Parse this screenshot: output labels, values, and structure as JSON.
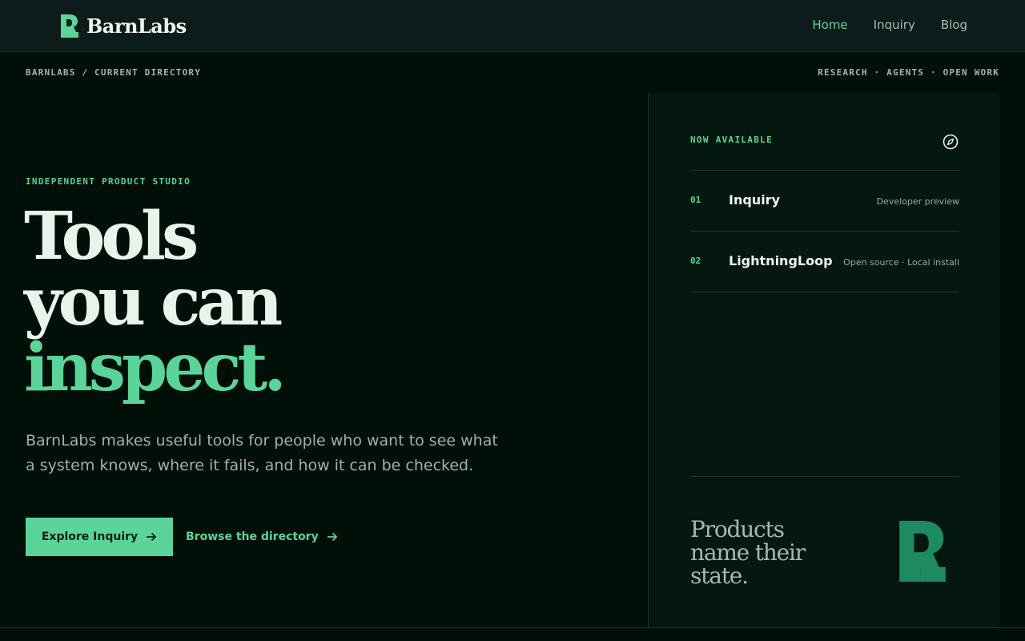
{
  "brand": {
    "name": "BarnLabs",
    "accent": "#5bd499",
    "background": "#000f08"
  },
  "nav": {
    "items": [
      {
        "label": "Home",
        "active": true
      },
      {
        "label": "Inquiry",
        "active": false
      },
      {
        "label": "Blog",
        "active": false
      }
    ]
  },
  "meta": {
    "breadcrumb": "BARNLABS / CURRENT DIRECTORY",
    "tags": "RESEARCH · AGENTS · OPEN WORK"
  },
  "hero": {
    "eyebrow": "INDEPENDENT PRODUCT STUDIO",
    "headline": {
      "line1": "Tools",
      "line2": "you can",
      "line3": "inspect."
    },
    "lede": "BarnLabs makes useful tools for people who want to see what a system knows, where it fails, and how it can be checked.",
    "primary_cta": "Explore Inquiry",
    "secondary_cta": "Browse the directory"
  },
  "panel": {
    "heading": "NOW AVAILABLE",
    "heading_icon": "compass-icon",
    "products": [
      {
        "number": "01",
        "name": "Inquiry",
        "status": "Developer preview"
      },
      {
        "number": "02",
        "name": "LightningLoop",
        "status": "Open source · Local install"
      }
    ],
    "tagline": {
      "line1": "Products",
      "line2": "name their",
      "line3": "state."
    },
    "mark_color": "#1e8a62"
  }
}
